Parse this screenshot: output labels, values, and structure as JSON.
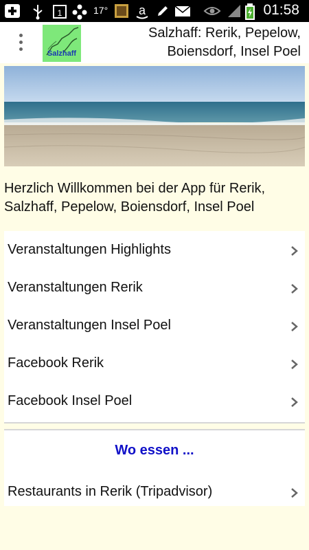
{
  "status_bar": {
    "temperature": "17°",
    "time": "01:58"
  },
  "action_bar": {
    "logo_text": "Salzhaff",
    "title": "Salzhaff: Rerik, Pepelow, Boiensdorf, Insel Poel"
  },
  "welcome_text": "Herzlich Willkommen bei der App für Rerik, Salzhaff, Pepelow, Boiensdorf, Insel Poel",
  "menu": {
    "items": [
      {
        "label": "Veranstaltungen Highlights"
      },
      {
        "label": "Veranstaltungen Rerik"
      },
      {
        "label": "Veranstaltungen Insel Poel"
      },
      {
        "label": "Facebook Rerik"
      },
      {
        "label": "Facebook Insel Poel"
      }
    ]
  },
  "food_section": {
    "heading": "Wo essen ...",
    "items": [
      {
        "label": "Restaurants in Rerik (Tripadvisor)"
      }
    ]
  },
  "colors": {
    "background": "#fffde6",
    "section_heading": "#1010c8",
    "logo_bg": "#7ee87a"
  }
}
